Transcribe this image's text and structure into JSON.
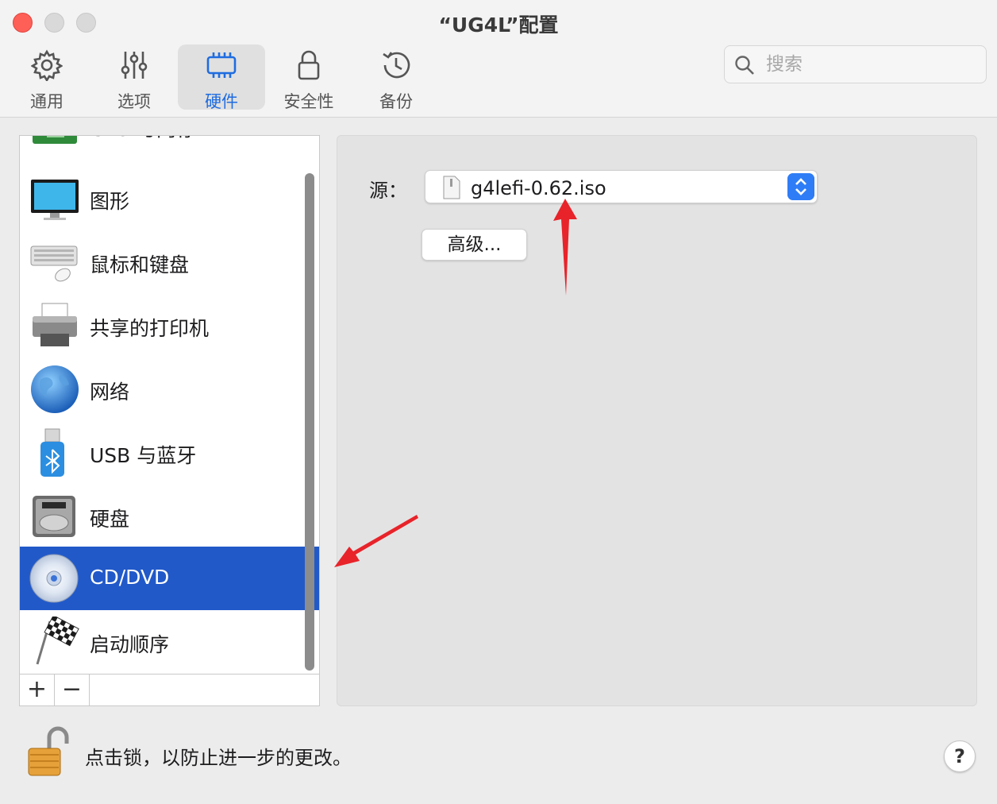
{
  "window": {
    "title": "“UG4L”配置"
  },
  "toolbar": {
    "items": [
      {
        "label": "通用",
        "icon": "gear-icon"
      },
      {
        "label": "选项",
        "icon": "sliders-icon"
      },
      {
        "label": "硬件",
        "icon": "chip-icon",
        "active": true
      },
      {
        "label": "安全性",
        "icon": "lock-icon"
      },
      {
        "label": "备份",
        "icon": "history-icon"
      }
    ],
    "search_placeholder": "搜索"
  },
  "device_list": {
    "items": [
      {
        "label": "CPU 与内存",
        "icon": "cpu-icon",
        "partially_visible": true
      },
      {
        "label": "图形",
        "icon": "display-icon"
      },
      {
        "label": "鼠标和键盘",
        "icon": "keyboard-mouse-icon"
      },
      {
        "label": "共享的打印机",
        "icon": "printer-icon"
      },
      {
        "label": "网络",
        "icon": "globe-icon"
      },
      {
        "label": "USB 与蓝牙",
        "icon": "usb-bluetooth-icon"
      },
      {
        "label": "硬盘",
        "icon": "hard-disk-icon"
      },
      {
        "label": "CD/DVD",
        "icon": "cd-icon",
        "selected": true
      },
      {
        "label": "启动顺序",
        "icon": "checkered-flag-icon"
      }
    ],
    "footer": {
      "add_label": "+",
      "remove_label": "−"
    }
  },
  "detail": {
    "source_label": "源：",
    "source_value": "g4lefi-0.62.iso",
    "advanced_button": "高级..."
  },
  "footer": {
    "lock_text": "点击锁，以防止进一步的更改。",
    "help_label": "?"
  },
  "colors": {
    "accent": "#2159c9",
    "active_tab": "#1f6ce0",
    "annotation_arrow": "#e8232a"
  }
}
